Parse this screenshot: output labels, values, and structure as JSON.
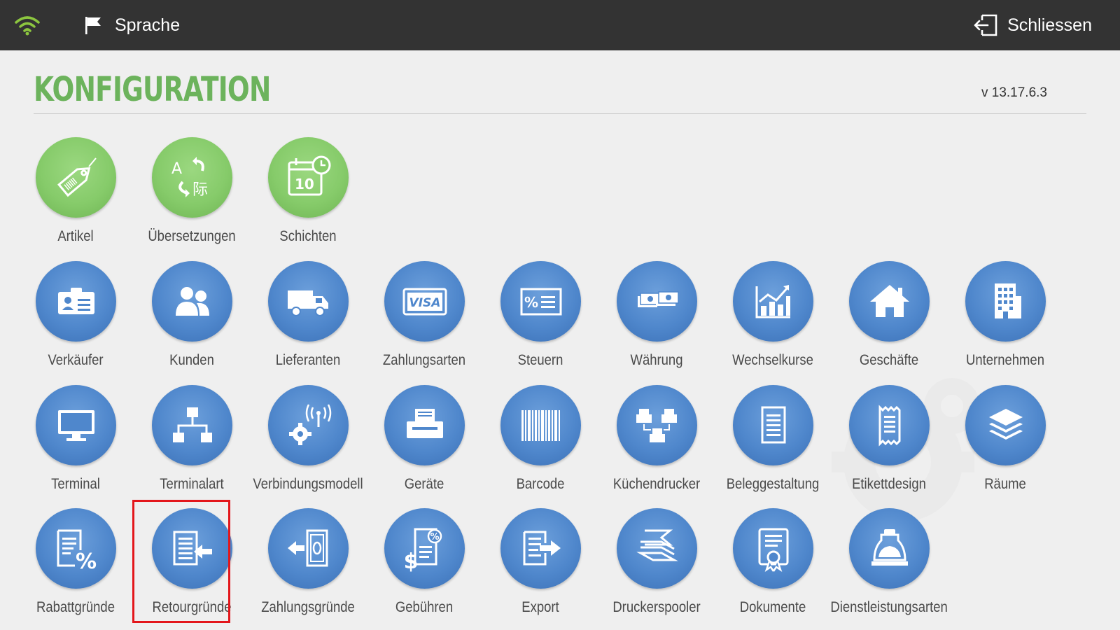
{
  "topbar": {
    "wifi_icon": "wifi-icon",
    "language_label": "Sprache",
    "language_icon": "flag-icon",
    "close_label": "Schliessen",
    "close_icon": "exit-icon"
  },
  "page": {
    "title": "KONFIGURATION",
    "version": "v 13.17.6.3"
  },
  "colors": {
    "topbar": "#333333",
    "title_green": "#6cb35c",
    "tile_green": "#86cb6a",
    "tile_blue": "#4f87cc",
    "selection_red": "#e3161b"
  },
  "tiles": {
    "artikel": {
      "label": "Artikel",
      "icon": "price-tag-icon"
    },
    "uebersetzungen": {
      "label": "Übersetzungen",
      "icon": "translate-icon"
    },
    "schichten": {
      "label": "Schichten",
      "icon": "calendar-clock-icon"
    },
    "verkaeufer": {
      "label": "Verkäufer",
      "icon": "id-card-icon"
    },
    "kunden": {
      "label": "Kunden",
      "icon": "users-icon"
    },
    "lieferanten": {
      "label": "Lieferanten",
      "icon": "truck-icon"
    },
    "zahlungsarten": {
      "label": "Zahlungsarten",
      "icon": "visa-card-icon"
    },
    "steuern": {
      "label": "Steuern",
      "icon": "percent-document-icon"
    },
    "waehrung": {
      "label": "Währung",
      "icon": "money-stack-icon"
    },
    "wechselkurse": {
      "label": "Wechselkurse",
      "icon": "chart-up-icon"
    },
    "geschaefte": {
      "label": "Geschäfte",
      "icon": "house-icon"
    },
    "unternehmen": {
      "label": "Unternehmen",
      "icon": "building-icon"
    },
    "terminal": {
      "label": "Terminal",
      "icon": "monitor-icon"
    },
    "terminalart": {
      "label": "Terminalart",
      "icon": "network-tree-icon"
    },
    "verbindungsmodell": {
      "label": "Verbindungsmodell",
      "icon": "gear-antenna-icon"
    },
    "geraete": {
      "label": "Geräte",
      "icon": "printer-icon"
    },
    "barcode": {
      "label": "Barcode",
      "icon": "barcode-icon"
    },
    "kuechendrucker": {
      "label": "Küchendrucker",
      "icon": "kitchen-printers-icon"
    },
    "beleggestaltung": {
      "label": "Beleggestaltung",
      "icon": "receipt-document-icon"
    },
    "etikettdesign": {
      "label": "Etikettdesign",
      "icon": "label-strip-icon"
    },
    "raeume": {
      "label": "Räume",
      "icon": "layers-icon"
    },
    "rabattgruende": {
      "label": "Rabattgründe",
      "icon": "document-percent-icon"
    },
    "retourgruende": {
      "label": "Retourgründe",
      "icon": "document-return-icon",
      "selected": true
    },
    "zahlungsgruende": {
      "label": "Zahlungsgründe",
      "icon": "banknote-arrow-icon"
    },
    "gebuehren": {
      "label": "Gebühren",
      "icon": "fee-document-icon"
    },
    "export": {
      "label": "Export",
      "icon": "document-export-icon"
    },
    "druckerspooler": {
      "label": "Druckerspooler",
      "icon": "paper-stack-icon"
    },
    "dokumente": {
      "label": "Dokumente",
      "icon": "certificate-icon"
    },
    "dienstleistungsarten": {
      "label": "Dienstleistungsarten",
      "icon": "bell-service-icon"
    }
  }
}
